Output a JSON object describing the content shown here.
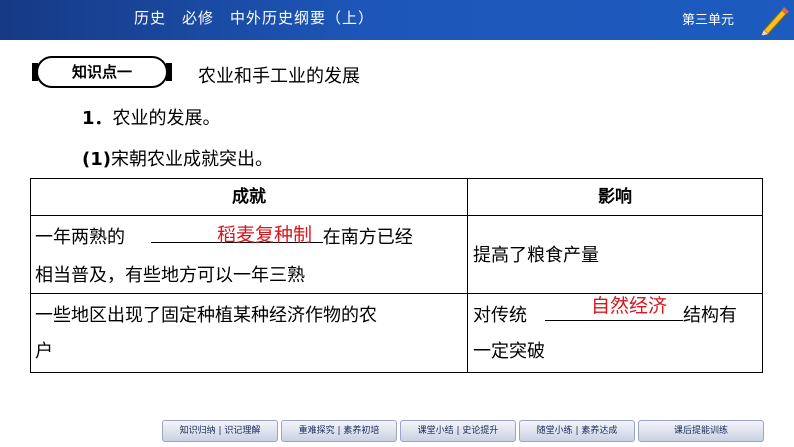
{
  "header": {
    "title": "历史　必修　中外历史纲要（上）",
    "unit": "第三单元"
  },
  "badge": "知识点一",
  "section_title": "农业和手工业的发展",
  "subheading1": {
    "num": "1．",
    "text": "农业的发展。"
  },
  "subheading2": {
    "num": "(1)",
    "text": "宋朝农业成就突出。"
  },
  "table": {
    "headers": [
      "成就",
      "影响"
    ],
    "row1": {
      "col1_line1_a": "一年两熟的",
      "col1_line1_b": "在南方已经",
      "col1_line2": "相当普及，有些地方可以一年三熟",
      "answer": "稻麦复种制",
      "col2": "提高了粮食产量"
    },
    "row2": {
      "col1_line1": "一些地区出现了固定种植某种经济作物的农",
      "col1_line2": "户",
      "col2_line1_a": "对传统",
      "col2_line1_b": "结构有",
      "col2_line2": "一定突破",
      "answer": "自然经济"
    }
  },
  "nav": [
    "知识归纳 | 识记理解",
    "重难探究 | 素养初培",
    "课堂小结 | 史论提升",
    "随堂小练 | 素养达成",
    "课后提能训练"
  ]
}
